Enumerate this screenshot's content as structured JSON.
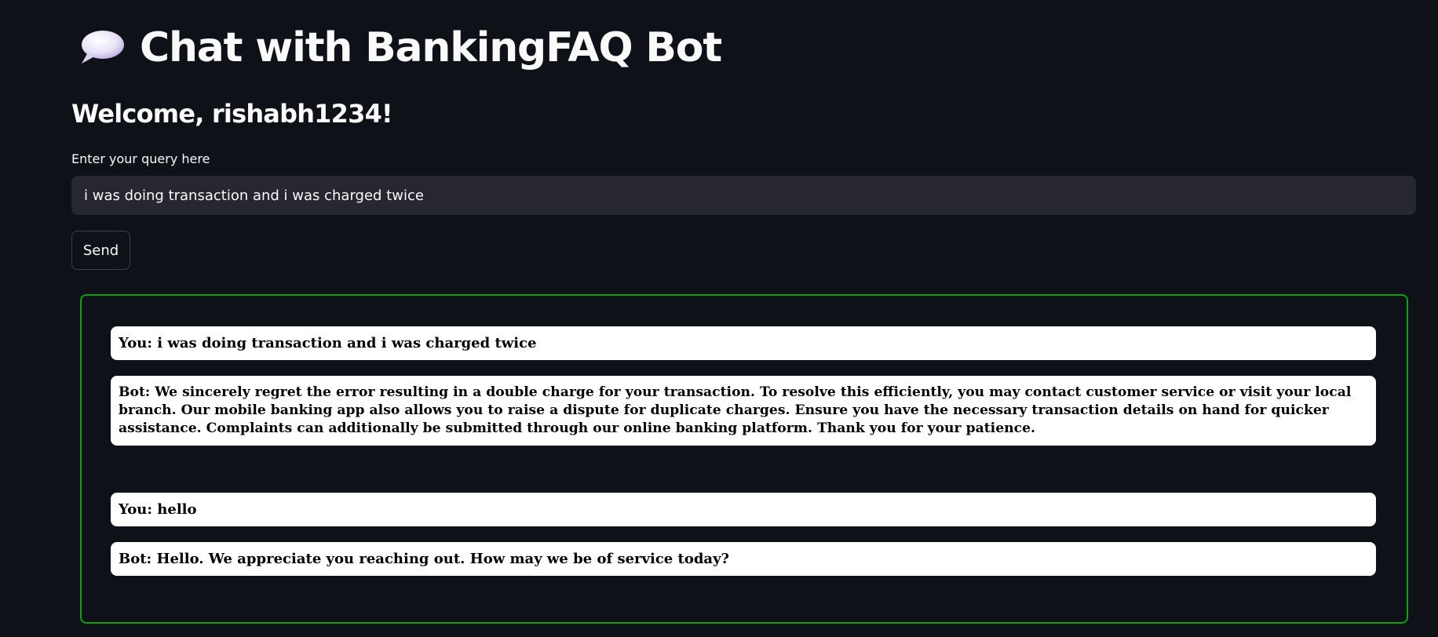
{
  "header": {
    "icon": "speech-balloon-icon",
    "title": "Chat with BankingFAQ Bot",
    "welcome": "Welcome, rishabh1234!"
  },
  "query": {
    "label": "Enter your query here",
    "value": "i was doing transaction and i was charged twice"
  },
  "send_button": {
    "label": "Send"
  },
  "chat": {
    "messages": [
      "You: i was doing transaction and i was charged twice",
      "Bot: We sincerely regret the error resulting in a double charge for your transaction. To resolve this efficiently, you may contact customer service or visit your local branch. Our mobile banking app also allows you to raise a dispute for duplicate charges. Ensure you have the necessary transaction details on hand for quicker assistance. Complaints can additionally be submitted through our online banking platform. Thank you for your patience.",
      "You: hello",
      "Bot: Hello. We appreciate you reaching out. How may we be of service today?"
    ]
  },
  "colors": {
    "background": "#0e1117",
    "input_background": "#262730",
    "chat_border": "#10a010",
    "message_background": "#ffffff"
  }
}
